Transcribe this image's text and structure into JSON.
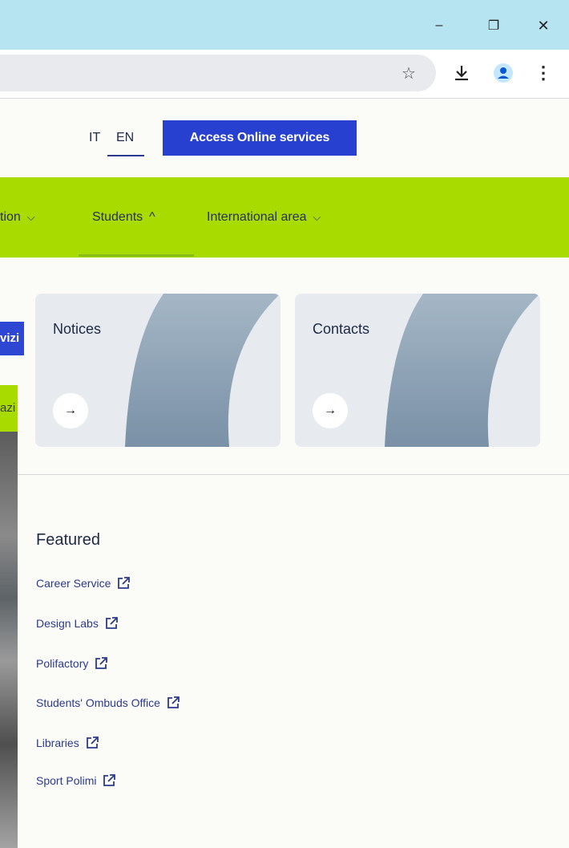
{
  "browser": {
    "minimize_glyph": "–",
    "restore_glyph": "❐",
    "close_glyph": "✕",
    "star_icon": "☆",
    "menu_glyph": "⋮"
  },
  "header": {
    "lang_it": "IT",
    "lang_en": "EN",
    "access_button": "Access Online services"
  },
  "nav": {
    "items": [
      {
        "label": "tion",
        "chevron": "⌵"
      },
      {
        "label": "Students",
        "chevron": "^"
      },
      {
        "label": "International area",
        "chevron": "⌵"
      }
    ]
  },
  "peek": {
    "blue_text": "vizi",
    "green_text": "azi"
  },
  "cards": [
    {
      "title": "Notices",
      "arrow": "→"
    },
    {
      "title": "Contacts",
      "arrow": "→"
    }
  ],
  "featured": {
    "title": "Featured",
    "links": [
      "Career Service",
      "Design Labs",
      "Polifactory",
      "Students' Ombuds Office",
      "Libraries",
      "Sport Polimi"
    ]
  },
  "colors": {
    "nav_green": "#a8dc00",
    "access_blue": "#2840d0",
    "link_blue": "#2b3a8c",
    "titlebar": "#b6e4f0"
  }
}
